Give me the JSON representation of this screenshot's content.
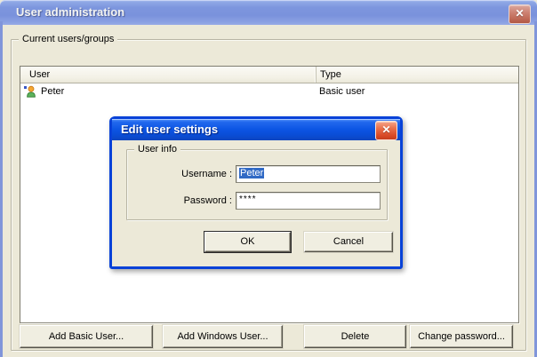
{
  "main_window": {
    "title": "User administration",
    "groupbox_label": "Current users/groups",
    "list": {
      "columns": [
        "User",
        "Type"
      ],
      "rows": [
        {
          "user": "Peter",
          "type": "Basic user"
        }
      ]
    },
    "buttons": [
      "Add Basic User...",
      "Add Windows User...",
      "Delete",
      "Change password..."
    ]
  },
  "dialog": {
    "title": "Edit user settings",
    "groupbox_label": "User info",
    "fields": {
      "username_label": "Username :",
      "username_value": "Peter",
      "password_label": "Password :",
      "password_value": "****"
    },
    "buttons": {
      "ok": "OK",
      "cancel": "Cancel"
    }
  },
  "icons": {
    "close": "✕"
  },
  "colors": {
    "client_bg": "#ECE9D8",
    "window_border_inactive": "#8095DA",
    "titlebar_inactive": "#7D96DE",
    "dialog_border_active": "#0842D8",
    "titlebar_active": "#0C55E4",
    "close_active": "#D94A26",
    "close_inactive": "#C06A57",
    "selection": "#316AC5"
  }
}
